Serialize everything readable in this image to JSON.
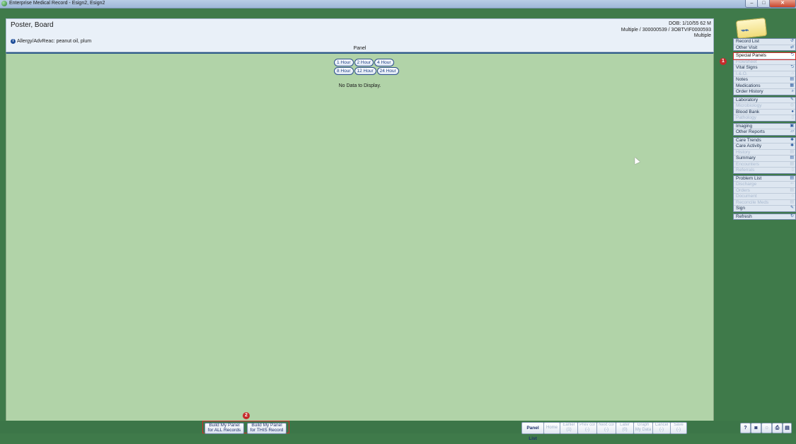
{
  "window": {
    "title": "Enterprise Medical Record - Esign2, Esign2",
    "minimize": "–",
    "maximize": "□",
    "close": "✕"
  },
  "patient": {
    "name": "Poster, Board",
    "allergy": "Allergy/AdvReac: peanut oil, plum",
    "dob": "DOB: 1/10/55 62 M",
    "ids": "Multiple / 300000539 / 3OBTVIF0000593",
    "location": "Multiple"
  },
  "panel": {
    "label": "Panel",
    "time_row1": [
      "1 Hour",
      "2 Hour",
      "4 Hour"
    ],
    "time_row2": [
      "8 Hour",
      "12 Hour",
      "24 Hour"
    ],
    "empty_message": "No Data to Display."
  },
  "sidebar": {
    "groups": [
      [
        {
          "label": "Record List",
          "icon": "↺",
          "enabled": true
        },
        {
          "label": "Other Visit",
          "icon": "⇄",
          "enabled": true
        }
      ],
      [
        {
          "label": "Special Panels",
          "icon": "⮌",
          "enabled": true,
          "selected": true
        },
        {
          "label": "Flowsheet",
          "icon": "",
          "enabled": false
        },
        {
          "label": "Vital Signs",
          "icon": "⮌",
          "enabled": true
        },
        {
          "label": "I.&.O.",
          "icon": "⌂",
          "enabled": false
        },
        {
          "label": "Notes",
          "icon": "▤",
          "enabled": true
        },
        {
          "label": "Medications",
          "icon": "▦",
          "enabled": true
        },
        {
          "label": "Order History",
          "icon": "⌕",
          "enabled": true
        }
      ],
      [
        {
          "label": "Laboratory",
          "icon": "✎",
          "enabled": true
        },
        {
          "label": "Microbiology",
          "icon": "◎",
          "enabled": false
        },
        {
          "label": "Blood Bank",
          "icon": "●",
          "enabled": true
        },
        {
          "label": "Pathology",
          "icon": "▯",
          "enabled": false
        }
      ],
      [
        {
          "label": "Imaging",
          "icon": "▣",
          "enabled": true
        },
        {
          "label": "Other Reports",
          "icon": "▱",
          "enabled": true
        }
      ],
      [
        {
          "label": "Care Trends",
          "icon": "✱",
          "enabled": true
        },
        {
          "label": "Care Activity",
          "icon": "✱",
          "enabled": true
        },
        {
          "label": "History",
          "icon": "▤",
          "enabled": false
        },
        {
          "label": "Summary",
          "icon": "▤",
          "enabled": true
        },
        {
          "label": "Encounters",
          "icon": "▤",
          "enabled": false
        },
        {
          "label": "Referrals",
          "icon": "▯",
          "enabled": false
        }
      ],
      [
        {
          "label": "Problem List",
          "icon": "▤",
          "enabled": true
        },
        {
          "label": "Discharge",
          "icon": "⇐",
          "enabled": false
        },
        {
          "label": "Orders",
          "icon": "▤",
          "enabled": false
        },
        {
          "label": "Document",
          "icon": "⌂",
          "enabled": false
        },
        {
          "label": "Reconcile Meds",
          "icon": "▤",
          "enabled": false
        },
        {
          "label": "Sign",
          "icon": "✎",
          "enabled": true
        }
      ],
      [
        {
          "label": "Refresh",
          "icon": "↻",
          "enabled": true
        }
      ]
    ]
  },
  "badges": {
    "step1": "1",
    "step2": "2"
  },
  "bottom": {
    "build_all": [
      "Build My Panel",
      "for ALL Records"
    ],
    "build_this": [
      "Build My Panel",
      "for THIS Record"
    ],
    "panel_list": "Panel List",
    "home": "Home",
    "earlier": [
      "Earlier",
      "(1)"
    ],
    "prev_col": [
      "Prev col",
      "(-)"
    ],
    "next_col": [
      "Next col",
      "(-)"
    ],
    "later": [
      "Later",
      "(0)"
    ],
    "graph": [
      "Graph",
      "My Data"
    ],
    "cancel": [
      "Cancel",
      "(-)"
    ],
    "save": [
      "Save",
      "(-)"
    ],
    "help": "?"
  }
}
